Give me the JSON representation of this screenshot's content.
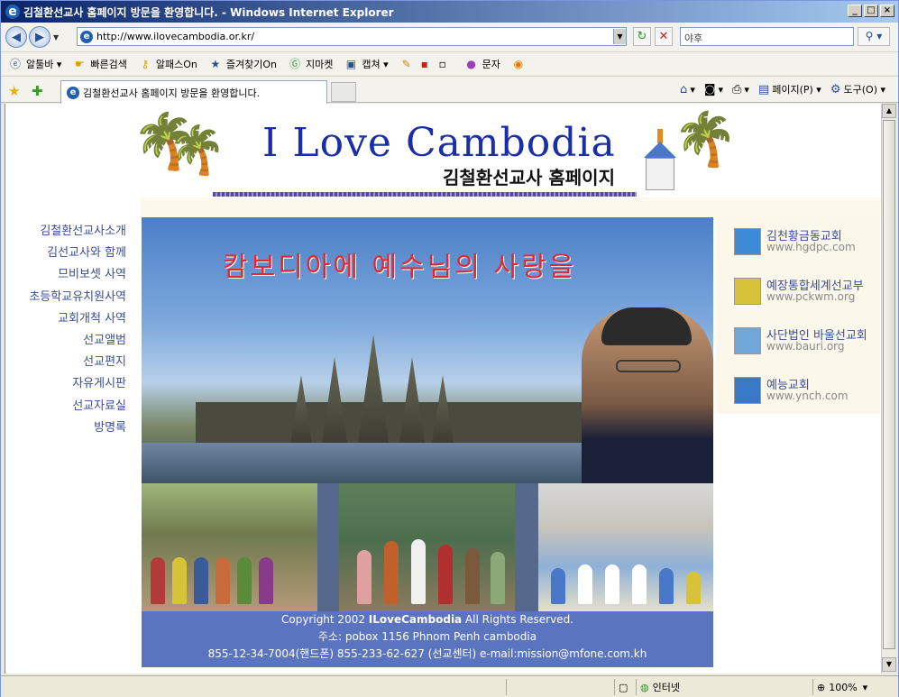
{
  "window": {
    "title": "김철환선교사 홈페이지 방문을 환영합니다. - Windows Internet Explorer",
    "min_label": "_",
    "max_label": "□",
    "close_label": "×"
  },
  "address": {
    "url": "http://www.ilovecambodia.or.kr/",
    "search_placeholder": "야후"
  },
  "toolbar": {
    "items": [
      {
        "label": "알툴바 ▾",
        "icon": "e-icon"
      },
      {
        "label": "빠른검색",
        "icon": "hand-icon"
      },
      {
        "label": "알패스On",
        "icon": "key-icon"
      },
      {
        "label": "즐겨찾기On",
        "icon": "star-icon"
      },
      {
        "label": "지마켓",
        "icon": "g-icon"
      },
      {
        "label": "캡쳐 ▾",
        "icon": "capture-icon"
      },
      {
        "label": "문자",
        "icon": "message-icon"
      }
    ]
  },
  "tabs": {
    "active": "김철환선교사 홈페이지 방문을 환영합니다."
  },
  "commands": {
    "page": "페이지(P) ▾",
    "tools": "도구(O) ▾"
  },
  "site": {
    "title": "I Love Cambodia",
    "subtitle": "김철환선교사 홈페이지",
    "hero_caption": "캄보디아에 예수님의 사랑을",
    "nav": [
      "김철환선교사소개",
      "김선교사와 함께",
      "므비보셋 사역",
      "초등학교유치원사역",
      "교회개척 사역",
      "선교앨범",
      "선교편지",
      "자유게시판",
      "선교자료실",
      "방명록"
    ],
    "links": [
      {
        "name": "김천황금동교회",
        "url": "www.hgdpc.com",
        "color": "#3d8ad6"
      },
      {
        "name": "예장통합세계선교부",
        "url": "www.pckwm.org",
        "color": "#d8c23a"
      },
      {
        "name": "사단법인 바울선교회",
        "url": "www.bauri.org",
        "color": "#6fa7d8"
      },
      {
        "name": "예능교회",
        "url": "www.ynch.com",
        "color": "#3a78c8"
      }
    ],
    "footer": {
      "copyright_pre": "Copyright 2002 ",
      "copyright_brand": "ILoveCambodia",
      "copyright_post": " All Rights Reserved.",
      "address": "주소: pobox 1156 Phnom Penh cambodia",
      "contact": "855-12-34-7004(핸드폰)   855-233-62-627 (선교센터)   e-mail:mission@mfone.com.kh"
    }
  },
  "status": {
    "zone": "인터넷",
    "zoom": "100%"
  }
}
